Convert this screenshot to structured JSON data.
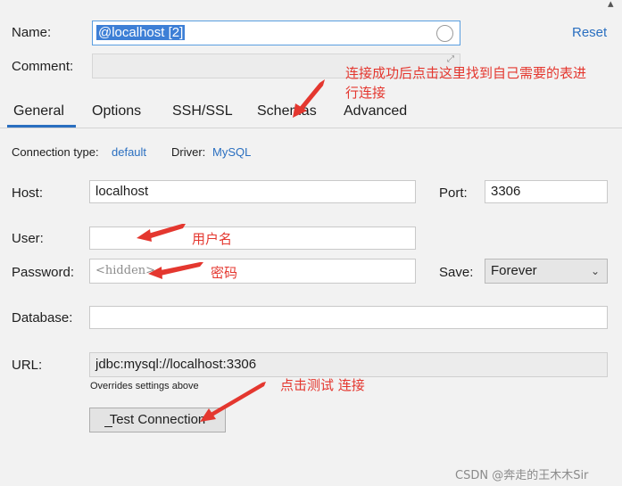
{
  "name_label": "Name:",
  "name_value": "@localhost [2]",
  "reset_label": "Reset",
  "comment_label": "Comment:",
  "tabs": [
    "General",
    "Options",
    "SSH/SSL",
    "Schemas",
    "Advanced"
  ],
  "conn_type_label": "Connection type:",
  "conn_type_value": "default",
  "driver_label": "Driver:",
  "driver_value": "MySQL",
  "host_label": "Host:",
  "host_value": "localhost",
  "port_label": "Port:",
  "port_value": "3306",
  "user_label": "User:",
  "user_value": "",
  "password_label": "Password:",
  "password_value": "<hidden>",
  "save_label": "Save:",
  "save_value": "Forever",
  "database_label": "Database:",
  "database_value": "",
  "url_label": "URL:",
  "url_value": "jdbc:mysql://localhost:3306",
  "url_note": "Overrides settings above",
  "test_button": "Test Connection",
  "annotations": {
    "schemas_line1": "连接成功后点击这里找到自己需要的表进",
    "schemas_line2": "行连接",
    "user": "用户名",
    "password": "密码",
    "test": "点击测试 连接"
  },
  "watermark": "CSDN @奔走的王木木Sir",
  "colors": {
    "annotation": "#e4372f",
    "link": "#2a6fc0",
    "name_highlight": "#3d7fd6"
  }
}
